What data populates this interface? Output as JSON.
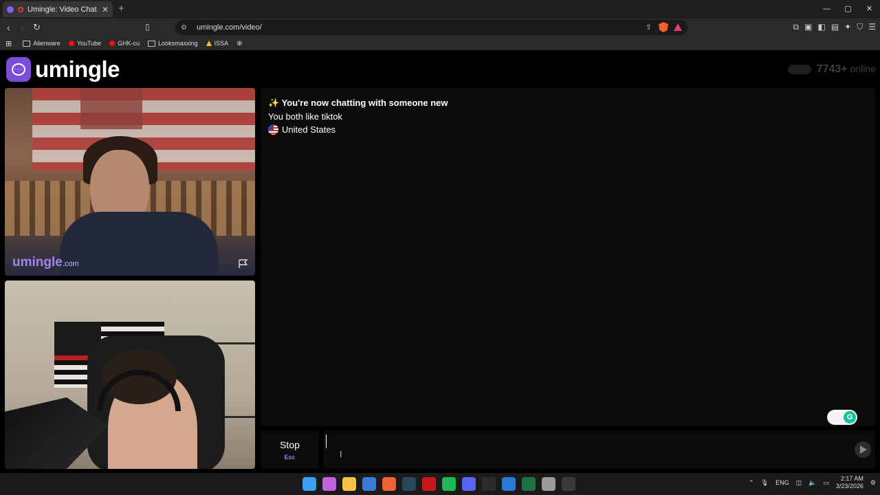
{
  "browser": {
    "tab_title": "Umingle: Video Chat with Str",
    "tab_close": "✕",
    "new_tab": "+",
    "url": "umingle.com/video/",
    "window_controls": [
      "—",
      "▢",
      "✕"
    ],
    "bookmarks": [
      {
        "label": "Alienware",
        "icon": "folder-icon"
      },
      {
        "label": "YouTube",
        "icon": "youtube-icon"
      },
      {
        "label": "GHK-cu",
        "icon": "youtube-icon"
      },
      {
        "label": "Looksmaxxing",
        "icon": "folder-icon"
      },
      {
        "label": "ISSA",
        "icon": "triangle-icon"
      }
    ]
  },
  "site": {
    "logo_text": "umingle",
    "online_count": "7743+",
    "online_label": "online",
    "watermark_brand": "umingle",
    "watermark_tld": ".com"
  },
  "chat": {
    "sparkle": "✨",
    "headline": "You're now chatting with someone new",
    "shared_interest": "You both like tiktok",
    "country": "United States",
    "message_value": "",
    "grammarly_letter": "G"
  },
  "controls": {
    "stop_label": "Stop",
    "stop_shortcut": "Esc"
  },
  "taskbar": {
    "language": "ENG",
    "time": "2:17 AM",
    "date": "3/23/2026",
    "apps": [
      {
        "name": "windows-start-icon",
        "color": "#3aa0f3"
      },
      {
        "name": "copilot-icon",
        "color": "#c063d8"
      },
      {
        "name": "file-explorer-icon",
        "color": "#f6c343"
      },
      {
        "name": "store-icon",
        "color": "#3a7bd5"
      },
      {
        "name": "brave-icon",
        "color": "#f06031"
      },
      {
        "name": "steam-icon",
        "color": "#2a475e"
      },
      {
        "name": "app-red-icon",
        "color": "#c8181e"
      },
      {
        "name": "spotify-icon",
        "color": "#1db954"
      },
      {
        "name": "discord-icon",
        "color": "#5865f2"
      },
      {
        "name": "epic-games-icon",
        "color": "#2b2b2b"
      },
      {
        "name": "app-blue-icon",
        "color": "#2b7ad6"
      },
      {
        "name": "excel-icon",
        "color": "#1f7244"
      },
      {
        "name": "chrome-icon",
        "color": "#9a9a9a"
      },
      {
        "name": "epic-games-active-icon",
        "color": "#3a3a3a"
      }
    ]
  },
  "colors": {
    "brand_purple": "#7c4ddb",
    "accent_purple": "#9b7cf7",
    "panel_bg": "#0b0b0b"
  }
}
